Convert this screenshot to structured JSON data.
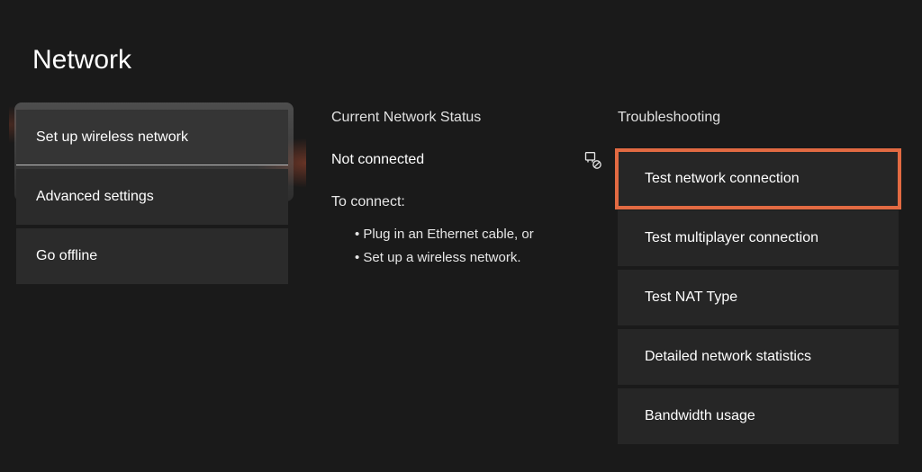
{
  "title": "Network",
  "left_menu": {
    "items": [
      {
        "label": "Set up wireless network",
        "focused": true
      },
      {
        "label": "Advanced settings",
        "focused": false
      },
      {
        "label": "Go offline",
        "focused": false
      }
    ]
  },
  "status": {
    "header": "Current Network Status",
    "value": "Not connected",
    "icon": "ethernet-disconnected-icon",
    "connect_header": "To connect:",
    "tips": [
      "Plug in an Ethernet cable, or",
      "Set up a wireless network."
    ]
  },
  "troubleshooting": {
    "header": "Troubleshooting",
    "items": [
      {
        "label": "Test network connection",
        "highlighted": true
      },
      {
        "label": "Test multiplayer connection",
        "highlighted": false
      },
      {
        "label": "Test NAT Type",
        "highlighted": false
      },
      {
        "label": "Detailed network statistics",
        "highlighted": false
      },
      {
        "label": "Bandwidth usage",
        "highlighted": false
      }
    ]
  },
  "colors": {
    "highlight": "#e26a42",
    "bg": "#1a1a1a"
  }
}
